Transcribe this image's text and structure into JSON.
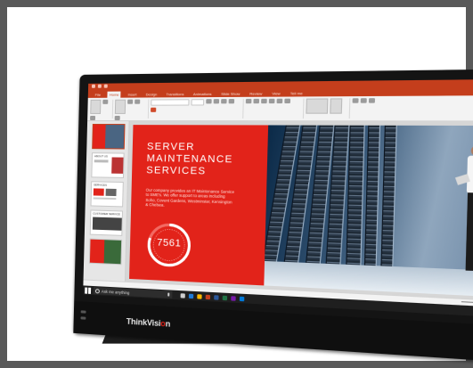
{
  "monitor": {
    "brand_main": "ThinkVision",
    "brand_accent": "#e2231a"
  },
  "powerpoint": {
    "accent": "#c43e1c",
    "tabs": [
      "File",
      "Home",
      "Insert",
      "Design",
      "Transitions",
      "Animations",
      "Slide Show",
      "Review",
      "View",
      "Tell me"
    ],
    "active_tab": "Home",
    "slide": {
      "title": "SERVER\nMAINTENANCE\nSERVICES",
      "body": "Our company provides an IT Maintenance Service to SME's. We offer support to areas including Soho, Covent Gardens, Westminster, Kensington & Chelsea.",
      "gauge_value": "7561",
      "gauge_fill": 0.8,
      "background_color": "#e2231a"
    },
    "thumbnails": [
      "",
      "ABOUT US",
      "SERVICES",
      "CUSTOMER SERVICE",
      ""
    ]
  },
  "taskbar": {
    "search_placeholder": "Ask me anything",
    "app_icon_colors": [
      "#cfcfcf",
      "#1f7bd8",
      "#ffb900",
      "#c43e1c",
      "#2b579a",
      "#217346",
      "#7719aa",
      "#0078d7"
    ]
  }
}
